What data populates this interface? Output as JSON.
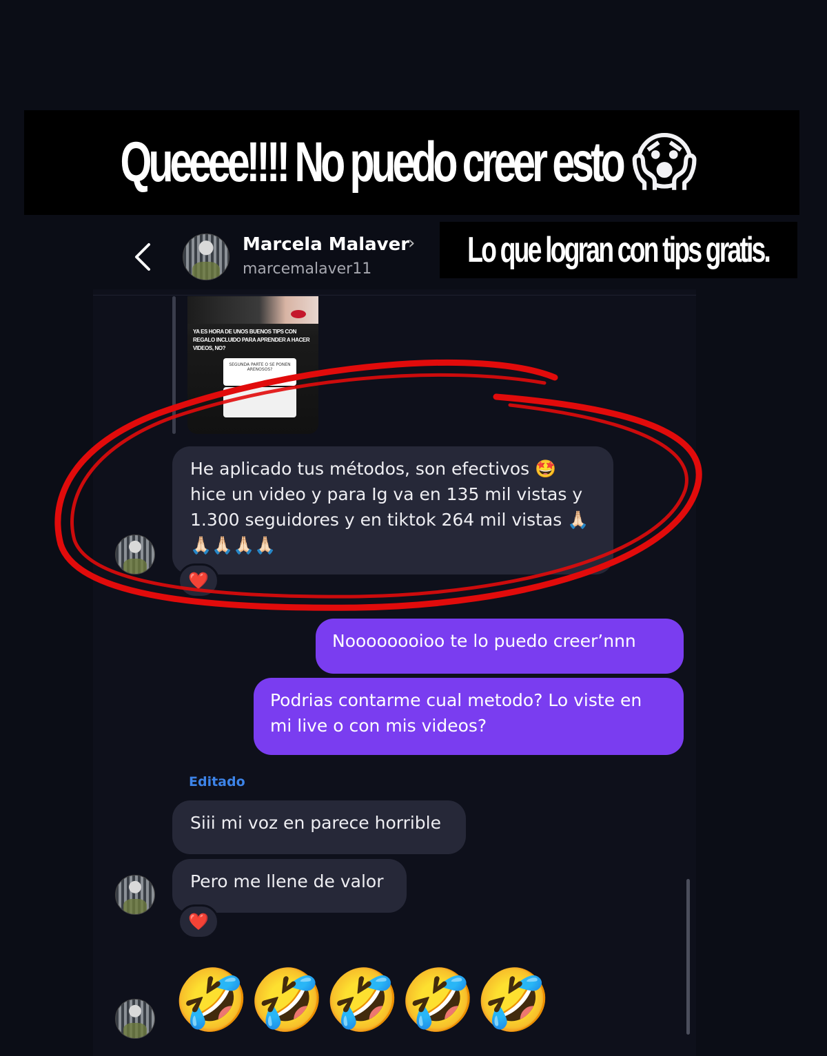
{
  "overlay": {
    "headline": "Queeee!!!!  No puedo creer esto",
    "headline_emoji": "😱",
    "subheadline": "Lo que logran con tips gratis."
  },
  "header": {
    "back_icon": "chevron-left-icon",
    "contact_name": "Marcela Malaver",
    "contact_chevron": "›",
    "username": "marcemalaver11"
  },
  "story_preview": {
    "headline": "YA ES HORA DE UNOS BUENOS TIPS CON REGALO INCLUIDO PARA APRENDER A HACER VIDEOS, NO?",
    "card_text": "SEGUNDA PARTE O SE PONEN ARENOSOS?"
  },
  "messages": {
    "incoming_1": "He aplicado tus métodos, son efectivos 🤩 hice un video y para Ig va en 135 mil vistas y 1.300 seguidores y en tiktok 264 mil vistas 🙏🏻🙏🏻🙏🏻🙏🏻🙏🏻",
    "incoming_1_reaction": "❤️",
    "outgoing_1": "Noooooooioo te lo puedo creer’nnn",
    "outgoing_2": "Podrias contarme cual metodo? Lo viste en mi live o con mis videos?",
    "edited_label": "Editado",
    "incoming_2": "Siii mi voz en parece horrible",
    "incoming_3": "Pero me llene de valor",
    "incoming_3_reaction": "❤️",
    "incoming_4": "🤣🤣🤣🤣🤣"
  },
  "colors": {
    "background": "#0b0d16",
    "incoming_bubble": "#262838",
    "outgoing_bubble": "#7a3df0",
    "edited_label": "#3d84e8",
    "annotation_circle": "#e10b0b"
  }
}
